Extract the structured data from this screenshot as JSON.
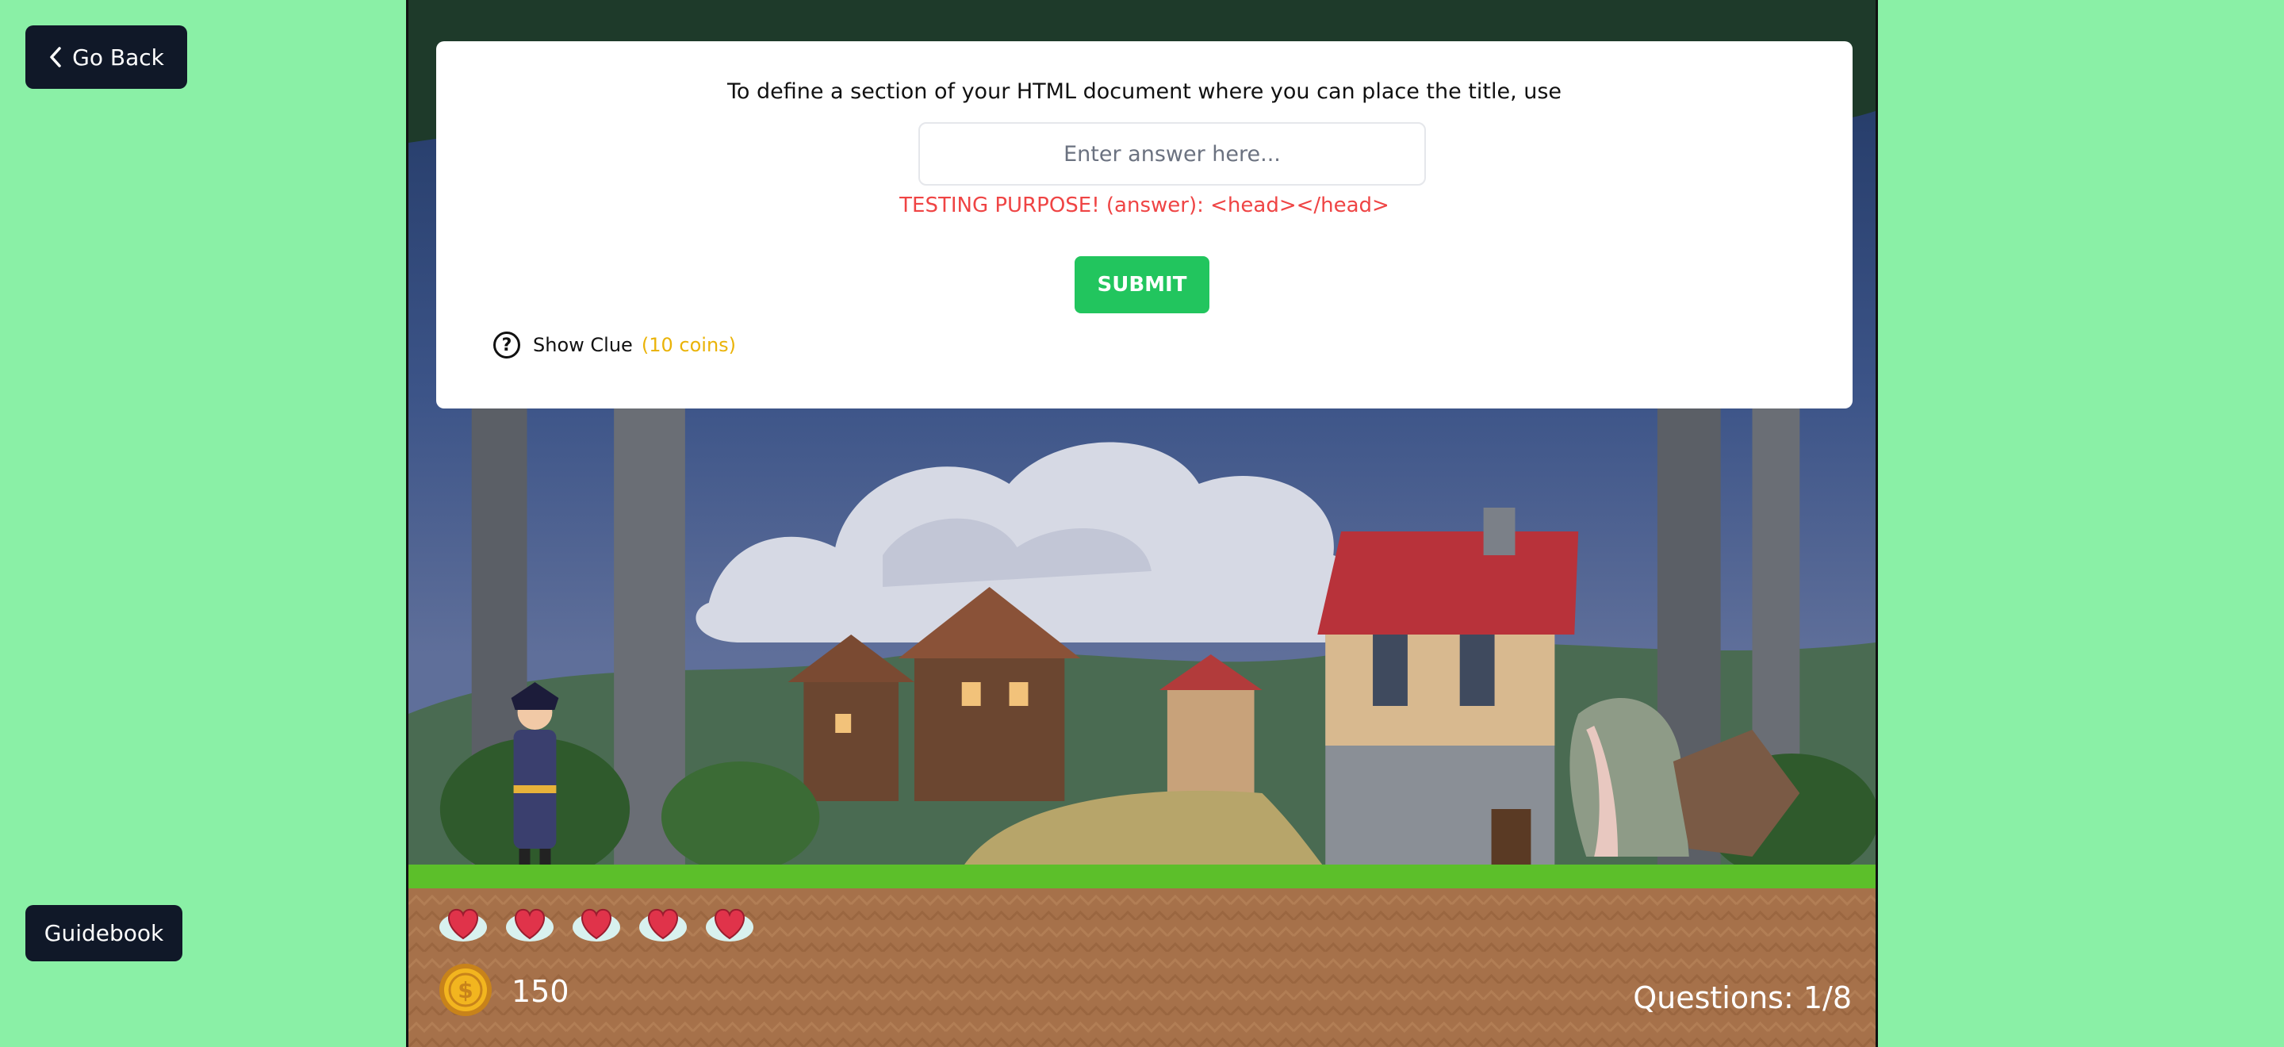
{
  "nav": {
    "go_back_label": "Go Back",
    "guidebook_label": "Guidebook"
  },
  "question": {
    "prompt": "To define a section of your HTML document where you can place the title, use",
    "input_placeholder": "Enter answer here...",
    "testing_hint": "TESTING PURPOSE! (answer): <head></head>",
    "submit_label": "SUBMIT",
    "clue_label": "Show Clue",
    "clue_cost": "(10 coins)"
  },
  "hud": {
    "lives": 5,
    "coins": "150",
    "questions": "Questions: 1/8"
  },
  "colors": {
    "page_background": "#8af0a6",
    "button_dark": "#101828",
    "submit_green": "#22c55e",
    "hint_red": "#ef4444",
    "clue_gold": "#eab308"
  },
  "icons": {
    "back": "chevron-left-icon",
    "help": "question-circle-icon",
    "life": "heart-icon",
    "coin": "coin-icon"
  }
}
